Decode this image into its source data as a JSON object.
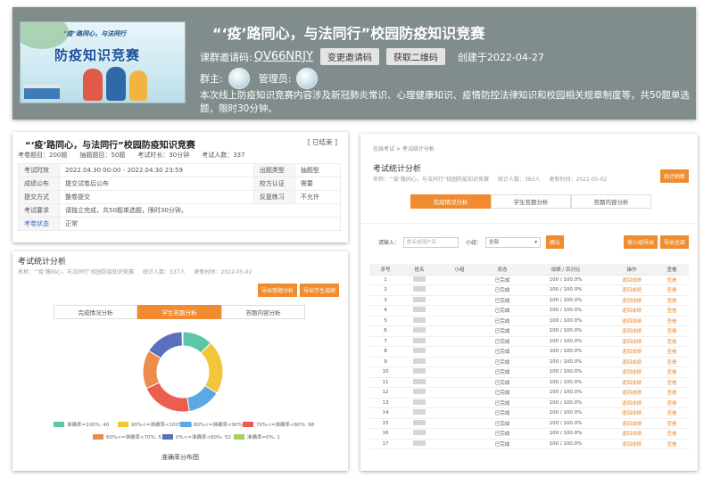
{
  "banner": {
    "image_caption": "\"疫\"路同心，与法同行",
    "image_title": "防疫知识竞赛",
    "title": "“‘疫’路同心，与法同行”校园防疫知识竞赛",
    "invite_label": "课群邀请码:",
    "invite_code": "QV66NRJY",
    "change_code_btn": "变更邀请码",
    "get_qr_btn": "获取二维码",
    "created": "创建于2022-04-27",
    "owner_label": "群主:",
    "admin_label": "管理员:",
    "description": "本次线上防疫知识竞赛内容涉及新冠肺炎常识、心理健康知识、疫情防控法律知识和校园相关规章制度等，共50题单选题，限时30分钟。"
  },
  "exam_info": {
    "title": "“‘疫’路同心，与法同行”校园防疫知识竞赛",
    "status": "[ 已结束 ]",
    "stats": [
      "考卷题目：200题",
      "抽题题目：50题",
      "考试时长：30分钟",
      "考试人数：337"
    ],
    "rows": [
      {
        "k1": "考试时效",
        "v1": "2022.04.30 00:00 - 2022.04.30 23:59",
        "k2": "出题类型",
        "v2": "抽题型"
      },
      {
        "k1": "成绩公布",
        "v1": "提交试卷后公布",
        "k2": "校方认证",
        "v2": "需要"
      },
      {
        "k1": "提交方式",
        "v1": "整卷提交",
        "k2": "反复练习",
        "v2": "不允许"
      },
      {
        "k1": "考试要求",
        "v1": "请独立完成，共50题单选题，限时30分钟。",
        "k2": "",
        "v2": ""
      },
      {
        "k1": "考卷状态",
        "v1": "正常",
        "k2": "",
        "v2": ""
      }
    ]
  },
  "left_stats": {
    "title": "考试统计分析",
    "meta_name": "名称：“‘疫’路同心，与法同行”校园防疫知识竞赛",
    "meta_count": "统计人数：337人",
    "meta_updated": "更新时间：2022-05-02",
    "export_btn1": "导出答题分析",
    "export_btn2": "导出学生成绩",
    "tabs": [
      "完成情况分析",
      "学生答题分析",
      "答题内容分析"
    ],
    "chart_caption": "准确率分布图"
  },
  "chart_data": {
    "type": "pie",
    "title": "准确率分布图",
    "categories": [
      "准确率=100%",
      "90%<=准确率<100%",
      "80%<=准确率<90%",
      "70%<=准确率<80%",
      "60%<=准确率<70%",
      "0%<=准确率<60%",
      "准确率=0%"
    ],
    "values": [
      40,
      71,
      44,
      68,
      51,
      52,
      1
    ],
    "legend_labels": [
      "准确率=100%: 40",
      "90%<=准确率<100%: 71",
      "80%<=准确率<90%: 44",
      "70%<=准确率<80%: 68",
      "60%<=准确率<70%: 51",
      "0%<=准确率<60%: 52",
      "准确率=0%: 1"
    ],
    "colors": [
      "#5cc7a6",
      "#f1c63b",
      "#5aa8e6",
      "#ea5d4f",
      "#ec8d4e",
      "#5a6fbd",
      "#a6cf63"
    ],
    "legend_position": "bottom"
  },
  "right_stats": {
    "breadcrumb": "在线考试 > 考试统计分析",
    "title": "考试统计分析",
    "meta_name": "名称：“‘疫’路同心，与法同行”校园防疫知识竞赛",
    "meta_count": "统计人数：383人",
    "meta_updated": "更新时间：2022-05-02",
    "top_btn": "统计刷新",
    "tabs": [
      "完成情况分析",
      "学生答题分析",
      "答题内容分析"
    ],
    "search_label": "请输入：",
    "search_placeholder": "姓名或用户名",
    "group_label": "小组：",
    "group_value": "全部",
    "confirm_btn": "确认",
    "btn_a": "按小组导出",
    "btn_b": "导出全部",
    "columns": [
      "序号",
      "姓名",
      "小组",
      "状态",
      "成绩 / 百分比",
      "操作",
      "查看"
    ],
    "rows": [
      {
        "n": "1",
        "status": "已完成",
        "score": "100 / 100.0%",
        "op": "退回成绩",
        "view": "查看"
      },
      {
        "n": "2",
        "status": "已完成",
        "score": "100 / 100.0%",
        "op": "退回成绩",
        "view": "查看"
      },
      {
        "n": "3",
        "status": "已完成",
        "score": "100 / 100.0%",
        "op": "退回成绩",
        "view": "查看"
      },
      {
        "n": "4",
        "status": "已完成",
        "score": "100 / 100.0%",
        "op": "退回成绩",
        "view": "查看"
      },
      {
        "n": "5",
        "status": "已完成",
        "score": "100 / 100.0%",
        "op": "退回成绩",
        "view": "查看"
      },
      {
        "n": "6",
        "status": "已完成",
        "score": "100 / 100.0%",
        "op": "退回成绩",
        "view": "查看"
      },
      {
        "n": "7",
        "status": "已完成",
        "score": "100 / 100.0%",
        "op": "退回成绩",
        "view": "查看"
      },
      {
        "n": "8",
        "status": "已完成",
        "score": "100 / 100.0%",
        "op": "退回成绩",
        "view": "查看"
      },
      {
        "n": "9",
        "status": "已完成",
        "score": "100 / 100.0%",
        "op": "退回成绩",
        "view": "查看"
      },
      {
        "n": "10",
        "status": "已完成",
        "score": "100 / 100.0%",
        "op": "退回成绩",
        "view": "查看"
      },
      {
        "n": "11",
        "status": "已完成",
        "score": "100 / 100.0%",
        "op": "退回成绩",
        "view": "查看"
      },
      {
        "n": "12",
        "status": "已完成",
        "score": "100 / 100.0%",
        "op": "退回成绩",
        "view": "查看"
      },
      {
        "n": "13",
        "status": "已完成",
        "score": "100 / 100.0%",
        "op": "退回成绩",
        "view": "查看"
      },
      {
        "n": "14",
        "status": "已完成",
        "score": "100 / 100.0%",
        "op": "退回成绩",
        "view": "查看"
      },
      {
        "n": "15",
        "status": "已完成",
        "score": "100 / 100.0%",
        "op": "退回成绩",
        "view": "查看"
      },
      {
        "n": "16",
        "status": "已完成",
        "score": "100 / 100.0%",
        "op": "退回成绩",
        "view": "查看"
      },
      {
        "n": "17",
        "status": "已完成",
        "score": "100 / 100.0%",
        "op": "退回成绩",
        "view": "查看"
      }
    ]
  }
}
